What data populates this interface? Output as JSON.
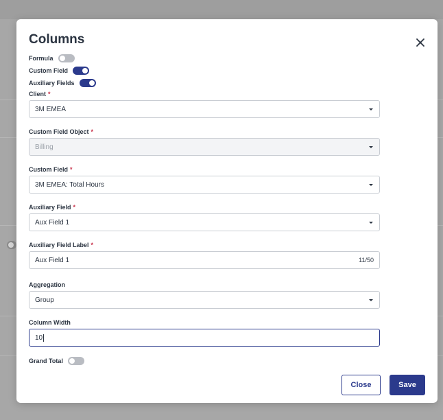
{
  "modal": {
    "title": "Columns",
    "close_icon": "close-icon"
  },
  "toggles": {
    "formula": {
      "label": "Formula",
      "on": false
    },
    "custom_field": {
      "label": "Custom Field",
      "on": true
    },
    "auxiliary_fields": {
      "label": "Auxiliary Fields",
      "on": true
    },
    "grand_total": {
      "label": "Grand Total",
      "on": false
    }
  },
  "fields": {
    "client": {
      "label": "Client",
      "required": "*",
      "value": "3M EMEA"
    },
    "custom_field_object": {
      "label": "Custom Field Object",
      "required": "*",
      "value": "Billing"
    },
    "custom_field": {
      "label": "Custom Field",
      "required": "*",
      "value": "3M EMEA: Total Hours"
    },
    "auxiliary_field": {
      "label": "Auxiliary Field",
      "required": "*",
      "value": "Aux Field 1"
    },
    "auxiliary_field_label": {
      "label": "Auxiliary Field Label",
      "required": "*",
      "value": "Aux Field 1",
      "counter": "11/50"
    },
    "aggregation": {
      "label": "Aggregation",
      "value": "Group"
    },
    "column_width": {
      "label": "Column Width",
      "value": "10"
    }
  },
  "buttons": {
    "close": "Close",
    "save": "Save"
  },
  "colors": {
    "primary": "#2b3a8c",
    "required": "#c8324a",
    "text": "#2b3441"
  }
}
